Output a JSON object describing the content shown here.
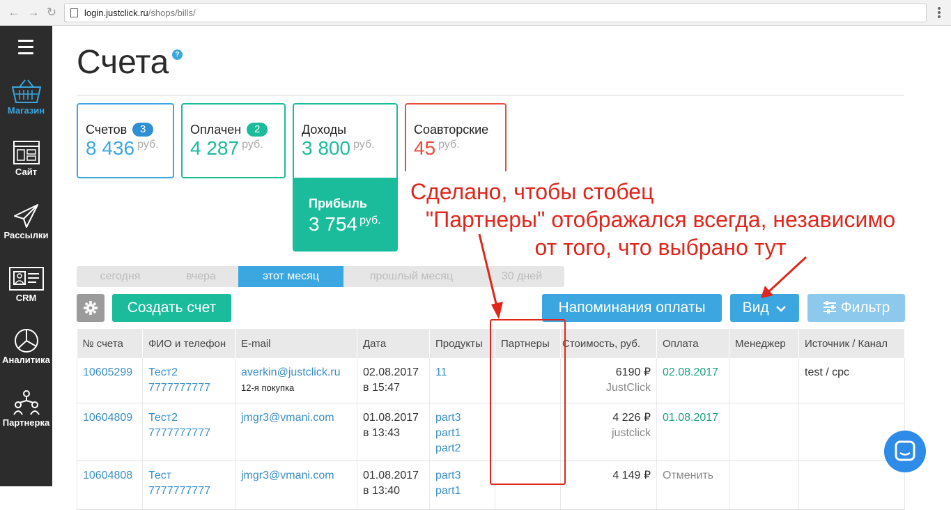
{
  "browser": {
    "url_host": "login.justclick.ru",
    "url_path": "/shops/bills/"
  },
  "sidebar": {
    "items": [
      {
        "label": "Магазин",
        "icon": "basket-icon",
        "active": true
      },
      {
        "label": "Сайт",
        "icon": "site-icon"
      },
      {
        "label": "Рассылки",
        "icon": "paper-plane-icon"
      },
      {
        "label": "CRM",
        "icon": "contact-card-icon"
      },
      {
        "label": "Аналитика",
        "icon": "pie-chart-icon"
      },
      {
        "label": "Партнерка",
        "icon": "partners-network-icon"
      }
    ]
  },
  "page": {
    "title": "Счета",
    "help": "?"
  },
  "cards": [
    {
      "title": "Счетов",
      "badge": "3",
      "value": "8 436",
      "unit": "руб.",
      "color": "#3ba6e0"
    },
    {
      "title": "Оплачен",
      "badge": "2",
      "value": "4 287",
      "unit": "руб.",
      "color": "#1abc9c"
    },
    {
      "title": "Доходы",
      "value": "3 800",
      "unit": "руб.",
      "color": "#1abc9c"
    },
    {
      "title": "Соавторские",
      "value": "45",
      "unit": "руб.",
      "color": "#e74c3c"
    }
  ],
  "profit": {
    "title": "Прибыль",
    "value": "3 754",
    "unit": "руб."
  },
  "annotation": {
    "line1": "Сделано, чтобы стобец",
    "line2": "\"Партнеры\" отображался всегда, независимо",
    "line3": "от того, что выбрано тут"
  },
  "periods": [
    "сегодня",
    "вчера",
    "этот месяц",
    "прошлый месяц",
    "30 дней"
  ],
  "toolbar": {
    "create": "Создать счет",
    "remind": "Напоминания оплаты",
    "view": "Вид",
    "filter": "Фильтр"
  },
  "table": {
    "headers": [
      "№ счета",
      "ФИО и телефон",
      "E-mail",
      "Дата",
      "Продукты",
      "Партнеры",
      "Стоимость, руб.",
      "Оплата",
      "Менеджер",
      "Источник / Канал"
    ],
    "rows": [
      {
        "id": "10605299",
        "name": "Тест2",
        "phone": "7777777777",
        "email": "averkin@justclick.ru",
        "note": "12-я покупка",
        "date": "02.08.2017",
        "time": "в 15:47",
        "products": [
          "11"
        ],
        "price": "6190 ₽",
        "seller": "JustClick",
        "payment": "02.08.2017",
        "source": "test / cpc"
      },
      {
        "id": "10604809",
        "name": "Тест2",
        "phone": "7777777777",
        "email": "jmgr3@vmani.com",
        "note": "",
        "date": "01.08.2017",
        "time": "в 13:43",
        "products": [
          "part3",
          "part1",
          "part2"
        ],
        "price": "4 226 ₽",
        "seller": "justclick",
        "payment": "01.08.2017",
        "source": ""
      },
      {
        "id": "10604808",
        "name": "Тест",
        "phone": "7777777777",
        "email": "jmgr3@vmani.com",
        "note": "",
        "date": "01.08.2017",
        "time": "в 13:40",
        "products": [
          "part3",
          "part1"
        ],
        "price": "4 149 ₽",
        "seller": "",
        "payment": "Отменить",
        "source": ""
      }
    ]
  }
}
